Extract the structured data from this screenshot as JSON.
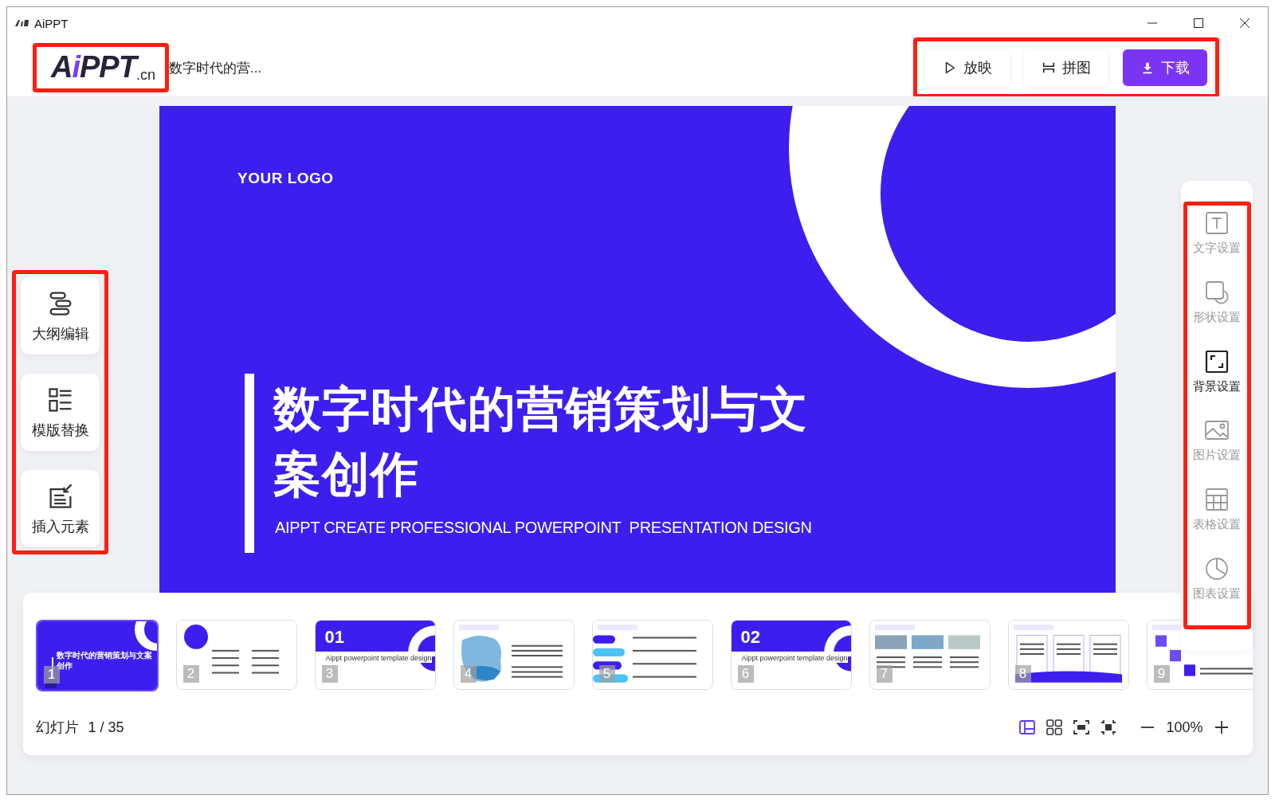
{
  "window": {
    "title": "AiPPT"
  },
  "header": {
    "logo": {
      "highlighted": true,
      "parts": [
        {
          "text": "A",
          "color": "#26233a"
        },
        {
          "text": "i",
          "color": "#7b3cf6"
        },
        {
          "text": "PPT",
          "color": "#26233a"
        },
        {
          "text": ".cn",
          "color": "#26233a"
        }
      ]
    },
    "doc_title": "数字时代的营...",
    "actions": {
      "highlighted": true,
      "buttons": [
        {
          "kind": "play",
          "label": "放映"
        },
        {
          "kind": "collage",
          "label": "拼图"
        },
        {
          "kind": "download",
          "label": "下载"
        }
      ]
    }
  },
  "left_tools": {
    "highlighted": true,
    "items": [
      {
        "kind": "outline",
        "label": "大纲编辑"
      },
      {
        "kind": "template",
        "label": "模版替换"
      },
      {
        "kind": "insert",
        "label": "插入元素"
      }
    ]
  },
  "slide": {
    "logo": "YOUR LOGO",
    "title": "数字时代的营销策划与文案创作",
    "subtitle": "AIPPT CREATE PROFESSIONAL POWERPOINT  PRESENTATION DESIGN"
  },
  "right_tools": {
    "highlighted": true,
    "items": [
      {
        "kind": "text",
        "label": "文字设置",
        "disabled": true
      },
      {
        "kind": "shape",
        "label": "形状设置",
        "disabled": true
      },
      {
        "kind": "background",
        "label": "背景设置",
        "disabled": false
      },
      {
        "kind": "image",
        "label": "图片设置",
        "disabled": true
      },
      {
        "kind": "table",
        "label": "表格设置",
        "disabled": true
      },
      {
        "kind": "chart",
        "label": "图表设置",
        "disabled": true
      }
    ]
  },
  "thumbnails": [
    {
      "kind": "cover",
      "number": "1",
      "selected": true,
      "title": "数字时代的营销策划与文案创作"
    },
    {
      "kind": "catalog",
      "number": "2",
      "selected": false
    },
    {
      "kind": "section",
      "number": "3",
      "selected": false,
      "heading": "01",
      "caption": "Aippt powerpoint template design"
    },
    {
      "kind": "image-text",
      "number": "4",
      "selected": false
    },
    {
      "kind": "list",
      "number": "5",
      "selected": false
    },
    {
      "kind": "section",
      "number": "6",
      "selected": false,
      "heading": "02",
      "caption": "Aippt powerpoint template design"
    },
    {
      "kind": "photos",
      "number": "7",
      "selected": false
    },
    {
      "kind": "columns",
      "number": "8",
      "selected": false
    },
    {
      "kind": "steps",
      "number": "9",
      "selected": false
    }
  ],
  "status": {
    "label": "幻灯片",
    "page": "1 / 35",
    "view_modes": [
      {
        "kind": "normal",
        "selected": true
      },
      {
        "kind": "grid",
        "selected": false
      },
      {
        "kind": "fit",
        "selected": false
      },
      {
        "kind": "fullscreen",
        "selected": false
      }
    ],
    "zoom": "100%"
  }
}
